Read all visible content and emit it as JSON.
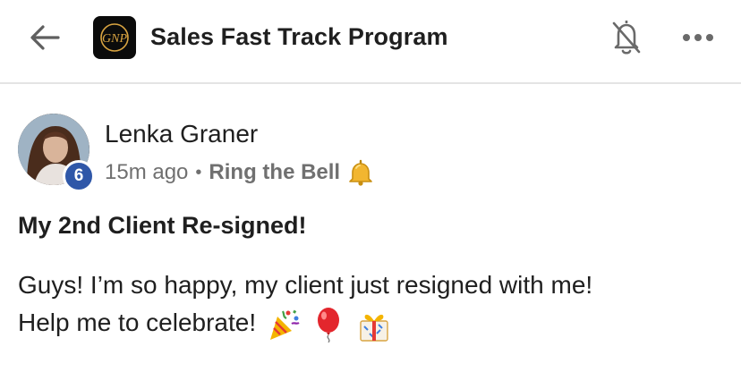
{
  "header": {
    "title": "Sales Fast Track Program",
    "logo_text": "GNP",
    "back_icon": "arrow-left-icon",
    "notification_icon": "bell-off-icon",
    "more_icon": "more-horizontal-icon"
  },
  "post": {
    "author": "Lenka Graner",
    "level_badge": "6",
    "timestamp": "15m ago",
    "separator": "•",
    "category": "Ring the Bell",
    "category_icon": "bell-emoji",
    "title": "My 2nd Client Re-signed!",
    "body_line1": "Guys! I’m so happy, my client just resigned with me!",
    "body_line2": "Help me to celebrate!",
    "body_emojis": [
      "party-popper-emoji",
      "balloon-emoji",
      "wrapped-gift-emoji"
    ]
  },
  "colors": {
    "badge": "#2f57a8",
    "meta_text": "#707070",
    "divider": "#e4e4e4",
    "logo_bg": "#0b0b0b",
    "logo_accent": "#d9a441"
  }
}
